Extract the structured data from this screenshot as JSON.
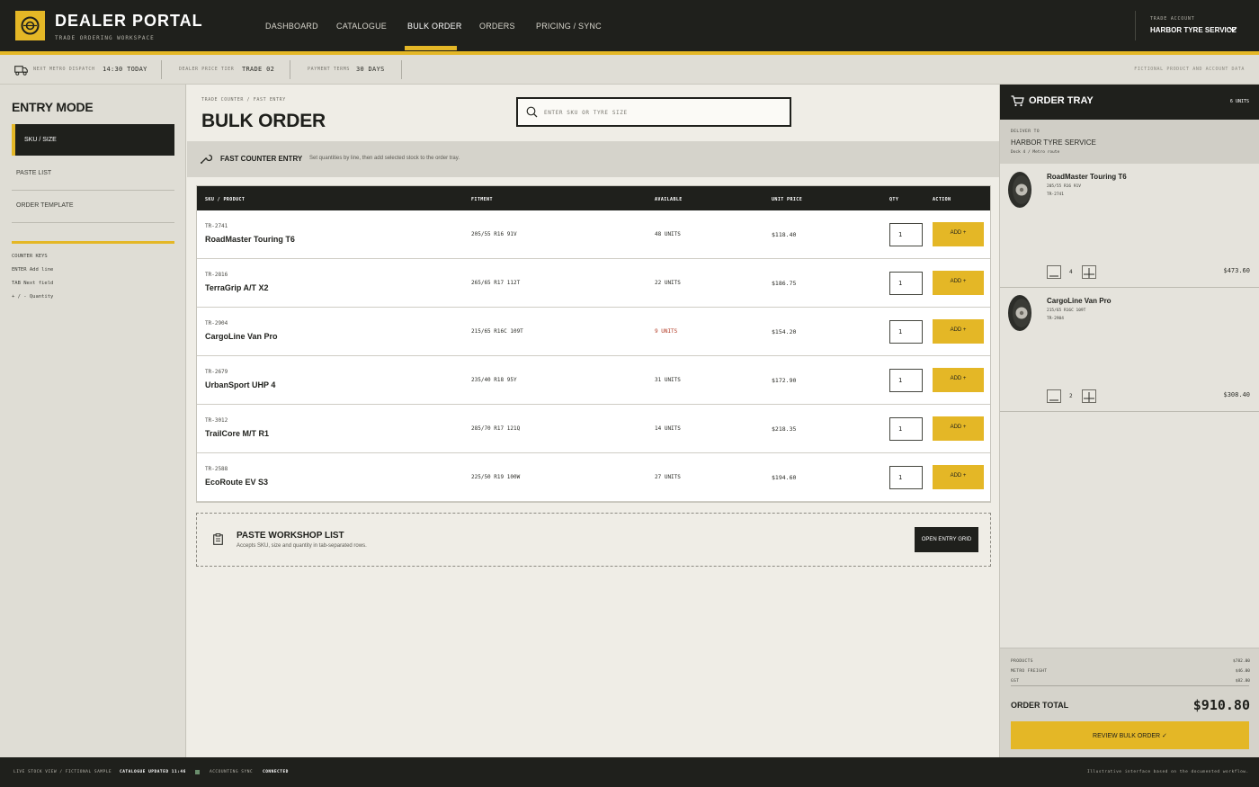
{
  "header": {
    "brand_title": "DEALER PORTAL",
    "brand_subtitle": "TRADE ORDERING WORKSPACE",
    "nav": [
      "DASHBOARD",
      "CATALOGUE",
      "BULK ORDER",
      "ORDERS",
      "PRICING / SYNC"
    ],
    "active_nav": "BULK ORDER",
    "account_label": "TRADE ACCOUNT",
    "account_name": "HARBOR TYRE SERVICE"
  },
  "infobar": {
    "dispatch_label": "NEXT METRO DISPATCH",
    "dispatch_value": "14:30 TODAY",
    "tier_label": "DEALER PRICE TIER",
    "tier_value": "TRADE 02",
    "terms_label": "PAYMENT TERMS",
    "terms_value": "30 DAYS",
    "note": "FICTIONAL PRODUCT AND ACCOUNT DATA"
  },
  "sidebar": {
    "title": "ENTRY MODE",
    "modes": [
      "SKU / SIZE",
      "PASTE LIST",
      "ORDER TEMPLATE"
    ],
    "keys": [
      "COUNTER KEYS",
      "ENTER Add line",
      "TAB Next field",
      "+ / - Quantity"
    ]
  },
  "main": {
    "breadcrumb": "TRADE COUNTER / FAST ENTRY",
    "title": "BULK ORDER",
    "search_placeholder": "ENTER SKU OR TYRE SIZE",
    "fast_title": "FAST COUNTER ENTRY",
    "fast_desc": "Set quantities by line, then add selected stock to the order tray.",
    "table_headers": [
      "SKU / PRODUCT",
      "FITMENT",
      "AVAILABLE",
      "UNIT PRICE",
      "QTY",
      "ACTION"
    ],
    "add_label": "ADD +",
    "rows": [
      {
        "sku": "TR-2741",
        "name": "RoadMaster Touring T6",
        "fitment": "205/55 R16 91V",
        "available": "48 UNITS",
        "low": false,
        "price": "$118.40",
        "qty": "1"
      },
      {
        "sku": "TR-2816",
        "name": "TerraGrip A/T X2",
        "fitment": "265/65 R17 112T",
        "available": "22 UNITS",
        "low": false,
        "price": "$186.75",
        "qty": "1"
      },
      {
        "sku": "TR-2904",
        "name": "CargoLine Van Pro",
        "fitment": "215/65 R16C 109T",
        "available": "9 UNITS",
        "low": true,
        "price": "$154.20",
        "qty": "1"
      },
      {
        "sku": "TR-2679",
        "name": "UrbanSport UHP 4",
        "fitment": "235/40 R18 95Y",
        "available": "31 UNITS",
        "low": false,
        "price": "$172.90",
        "qty": "1"
      },
      {
        "sku": "TR-3012",
        "name": "TrailCore M/T R1",
        "fitment": "285/70 R17 121Q",
        "available": "14 UNITS",
        "low": false,
        "price": "$218.35",
        "qty": "1"
      },
      {
        "sku": "TR-2588",
        "name": "EcoRoute EV S3",
        "fitment": "225/50 R19 100W",
        "available": "27 UNITS",
        "low": false,
        "price": "$194.60",
        "qty": "1"
      }
    ],
    "paste_title": "PASTE WORKSHOP LIST",
    "paste_desc": "Accepts SKU, size and quantity in tab-separated rows.",
    "paste_button": "OPEN ENTRY GRID"
  },
  "tray": {
    "title": "ORDER TRAY",
    "units": "6 UNITS",
    "deliver_label": "DELIVER TO",
    "deliver_name": "HARBOR TYRE SERVICE",
    "deliver_sub": "Dock 4 / Metro route",
    "lines": [
      {
        "name": "RoadMaster Touring T6",
        "spec": "205/55 R16 91V",
        "sku": "TR-2741",
        "qty": "4",
        "total": "$473.60"
      },
      {
        "name": "CargoLine Van Pro",
        "spec": "215/65 R16C 109T",
        "sku": "TR-2904",
        "qty": "2",
        "total": "$308.40"
      }
    ],
    "products_label": "PRODUCTS",
    "products_value": "$782.00",
    "freight_label": "METRO FREIGHT",
    "freight_value": "$46.00",
    "gst_label": "GST",
    "gst_value": "$82.80",
    "total_label": "ORDER TOTAL",
    "total_value": "$910.80",
    "review_button": "REVIEW BULK ORDER  ✓"
  },
  "footer": {
    "live": "LIVE STOCK VIEW / FICTIONAL SAMPLE",
    "catalogue": "CATALOGUE UPDATED 11:46",
    "sync_label": "ACCOUNTING SYNC",
    "sync_value": "CONNECTED",
    "disclaimer": "Illustrative interface based on the documented workflow."
  },
  "colors": {
    "accent": "#e4b726",
    "dark": "#1f201c",
    "warning": "#b23a24"
  }
}
